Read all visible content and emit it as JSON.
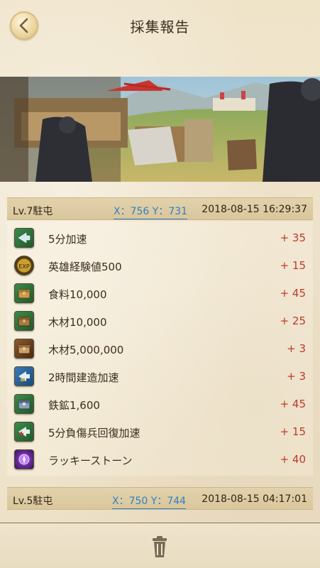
{
  "header": {
    "title": "採集報告",
    "back_icon": "chevron-left-icon"
  },
  "reports": [
    {
      "site": "Lv.7駐屯",
      "coords": "X：756 Y：731",
      "datetime": "2018-08-15  16:29:37",
      "items": [
        {
          "icon": "speedup-5min-icon",
          "label": "5分加速",
          "qty": "+ 35"
        },
        {
          "icon": "hero-exp-icon",
          "label": "英雄経験値500",
          "qty": "+ 15"
        },
        {
          "icon": "food-chest-icon",
          "label": "食料10,000",
          "qty": "+ 45"
        },
        {
          "icon": "wood-chest-icon",
          "label": "木材10,000",
          "qty": "+ 25"
        },
        {
          "icon": "wood-large-chest-icon",
          "label": "木材5,000,000",
          "qty": "+ 3"
        },
        {
          "icon": "build-speedup-icon",
          "label": "2時間建造加速",
          "qty": "+ 3"
        },
        {
          "icon": "iron-chest-icon",
          "label": "鉄鉱1,600",
          "qty": "+ 45"
        },
        {
          "icon": "heal-speedup-icon",
          "label": "5分負傷兵回復加速",
          "qty": "+ 15"
        },
        {
          "icon": "lucky-stone-icon",
          "label": "ラッキーストーン",
          "qty": "+ 40"
        }
      ]
    },
    {
      "site": "Lv.5駐屯",
      "coords": "X：750 Y：744",
      "datetime": "2018-08-15  04:17:01",
      "items": []
    }
  ],
  "footer": {
    "delete_icon": "trash-icon"
  },
  "colors": {
    "qty": "#c0392b",
    "coords": "#2f7fc4",
    "background": "#efe4cc"
  }
}
